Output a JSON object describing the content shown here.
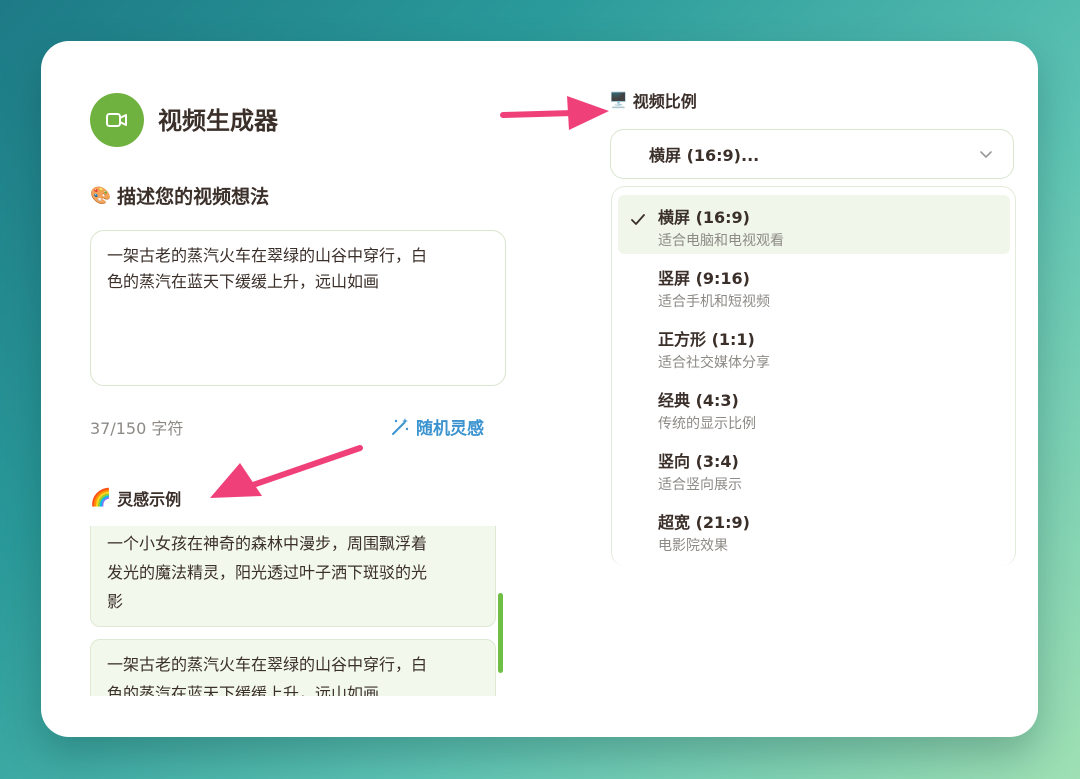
{
  "app": {
    "title": "视频生成器"
  },
  "prompt": {
    "section_title": "描述您的视频想法",
    "section_emoji": "🎨",
    "value_line1": "一架古老的蒸汽火车在翠绿的山谷中穿行，白",
    "value_line2": "色的蒸汽在蓝天下缓缓上升，远山如画",
    "counter": "37/150 字符",
    "random_label": "随机灵感"
  },
  "examples": {
    "section_title": "灵感示例",
    "section_emoji": "🌈",
    "items": [
      {
        "line1": "一个小女孩在神奇的森林中漫步，周围飘浮着",
        "line2": "发光的魔法精灵，阳光透过叶子洒下斑驳的光",
        "line3": "影"
      },
      {
        "line1": "一架古老的蒸汽火车在翠绿的山谷中穿行，白",
        "line2": "色的蒸汽在蓝天下缓缓上升，远山如画"
      }
    ]
  },
  "ratio": {
    "section_title": "视频比例",
    "section_emoji": "🖥️",
    "selected_display": "横屏 (16:9)...",
    "options": [
      {
        "name": "横屏 (16:9)",
        "desc": "适合电脑和电视观看"
      },
      {
        "name": "竖屏 (9:16)",
        "desc": "适合手机和短视频"
      },
      {
        "name": "正方形 (1:1)",
        "desc": "适合社交媒体分享"
      },
      {
        "name": "经典 (4:3)",
        "desc": "传统的显示比例"
      },
      {
        "name": "竖向 (3:4)",
        "desc": "适合竖向展示"
      },
      {
        "name": "超宽 (21:9)",
        "desc": "电影院效果"
      }
    ]
  },
  "colors": {
    "accent_green": "#6fb23f",
    "link_blue": "#3b93cf",
    "arrow_pink": "#f0407a"
  }
}
